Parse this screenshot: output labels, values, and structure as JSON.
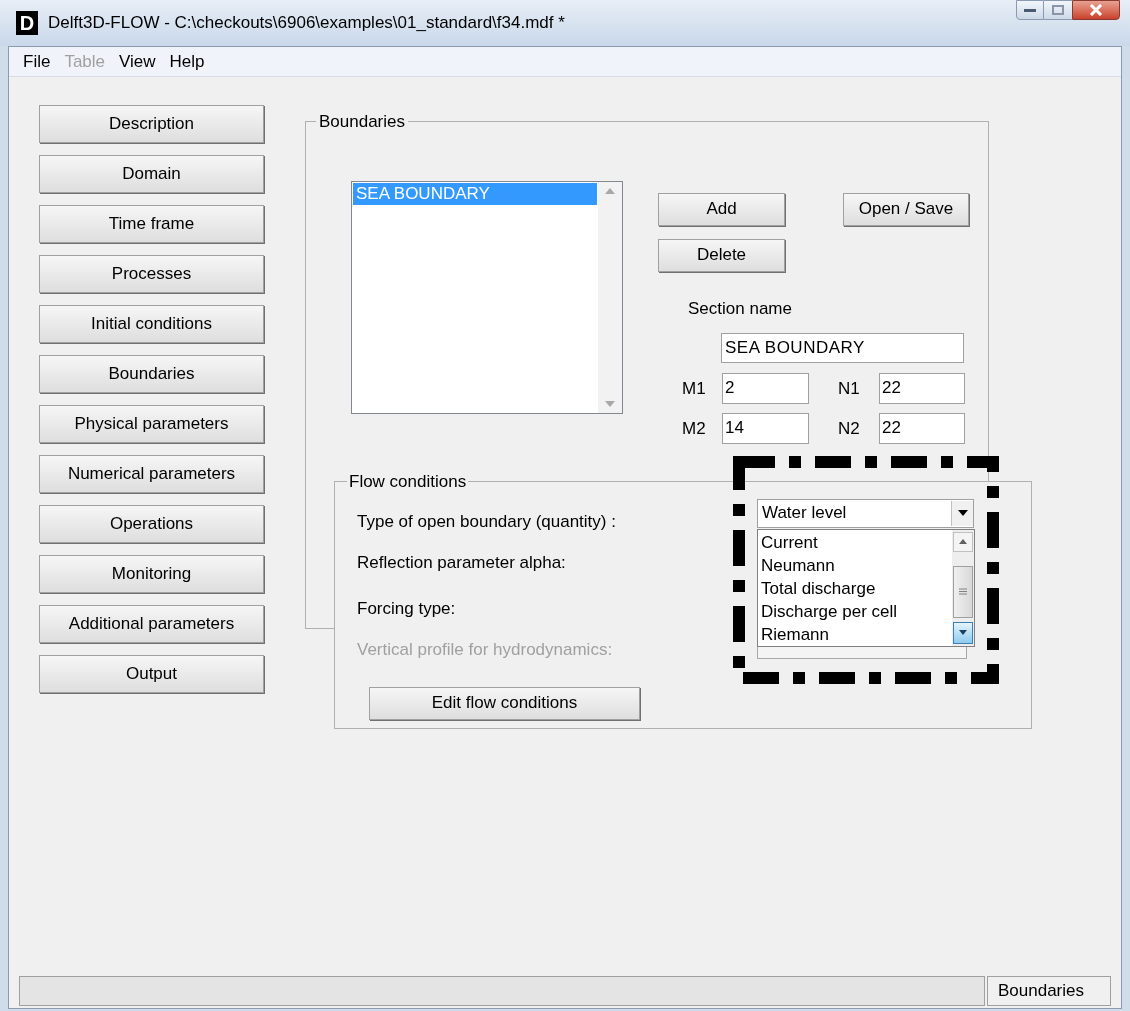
{
  "window": {
    "logo": "D",
    "title": "Delft3D-FLOW - C:\\checkouts\\6906\\examples\\01_standard\\f34.mdf *"
  },
  "menu": [
    {
      "label": "File",
      "disabled": false
    },
    {
      "label": "Table",
      "disabled": true
    },
    {
      "label": "View",
      "disabled": false
    },
    {
      "label": "Help",
      "disabled": false
    }
  ],
  "sidebar": [
    "Description",
    "Domain",
    "Time frame",
    "Processes",
    "Initial conditions",
    "Boundaries",
    "Physical parameters",
    "Numerical parameters",
    "Operations",
    "Monitoring",
    "Additional parameters",
    "Output"
  ],
  "boundaries": {
    "title": "Boundaries",
    "sections": [
      {
        "label": "SEA BOUNDARY",
        "selected": true
      }
    ],
    "add_button": "Add",
    "delete_button": "Delete",
    "open_save_button": "Open / Save",
    "section_name_label": "Section name",
    "section_name": "SEA BOUNDARY",
    "coordinates": [
      {
        "label": "M1",
        "value": "2"
      },
      {
        "label": "N1",
        "value": "22"
      },
      {
        "label": "M2",
        "value": "14"
      },
      {
        "label": "N2",
        "value": "22"
      }
    ]
  },
  "flow_conditions": {
    "title": "Flow conditions",
    "rows": [
      {
        "label": "Type of open boundary (quantity) :",
        "disabled": false
      },
      {
        "label": "Reflection parameter alpha:",
        "disabled": false
      },
      {
        "label": "Forcing type:",
        "disabled": false
      },
      {
        "label": "Vertical profile for hydrodynamics:",
        "disabled": true
      }
    ],
    "quantity": {
      "value": "Water level",
      "expanded": true,
      "options": [
        "Current",
        "Neumann",
        "Total discharge",
        "Discharge per cell",
        "Riemann"
      ]
    },
    "edit_button": "Edit flow conditions"
  },
  "status_bar": {
    "panel": "Boundaries"
  }
}
